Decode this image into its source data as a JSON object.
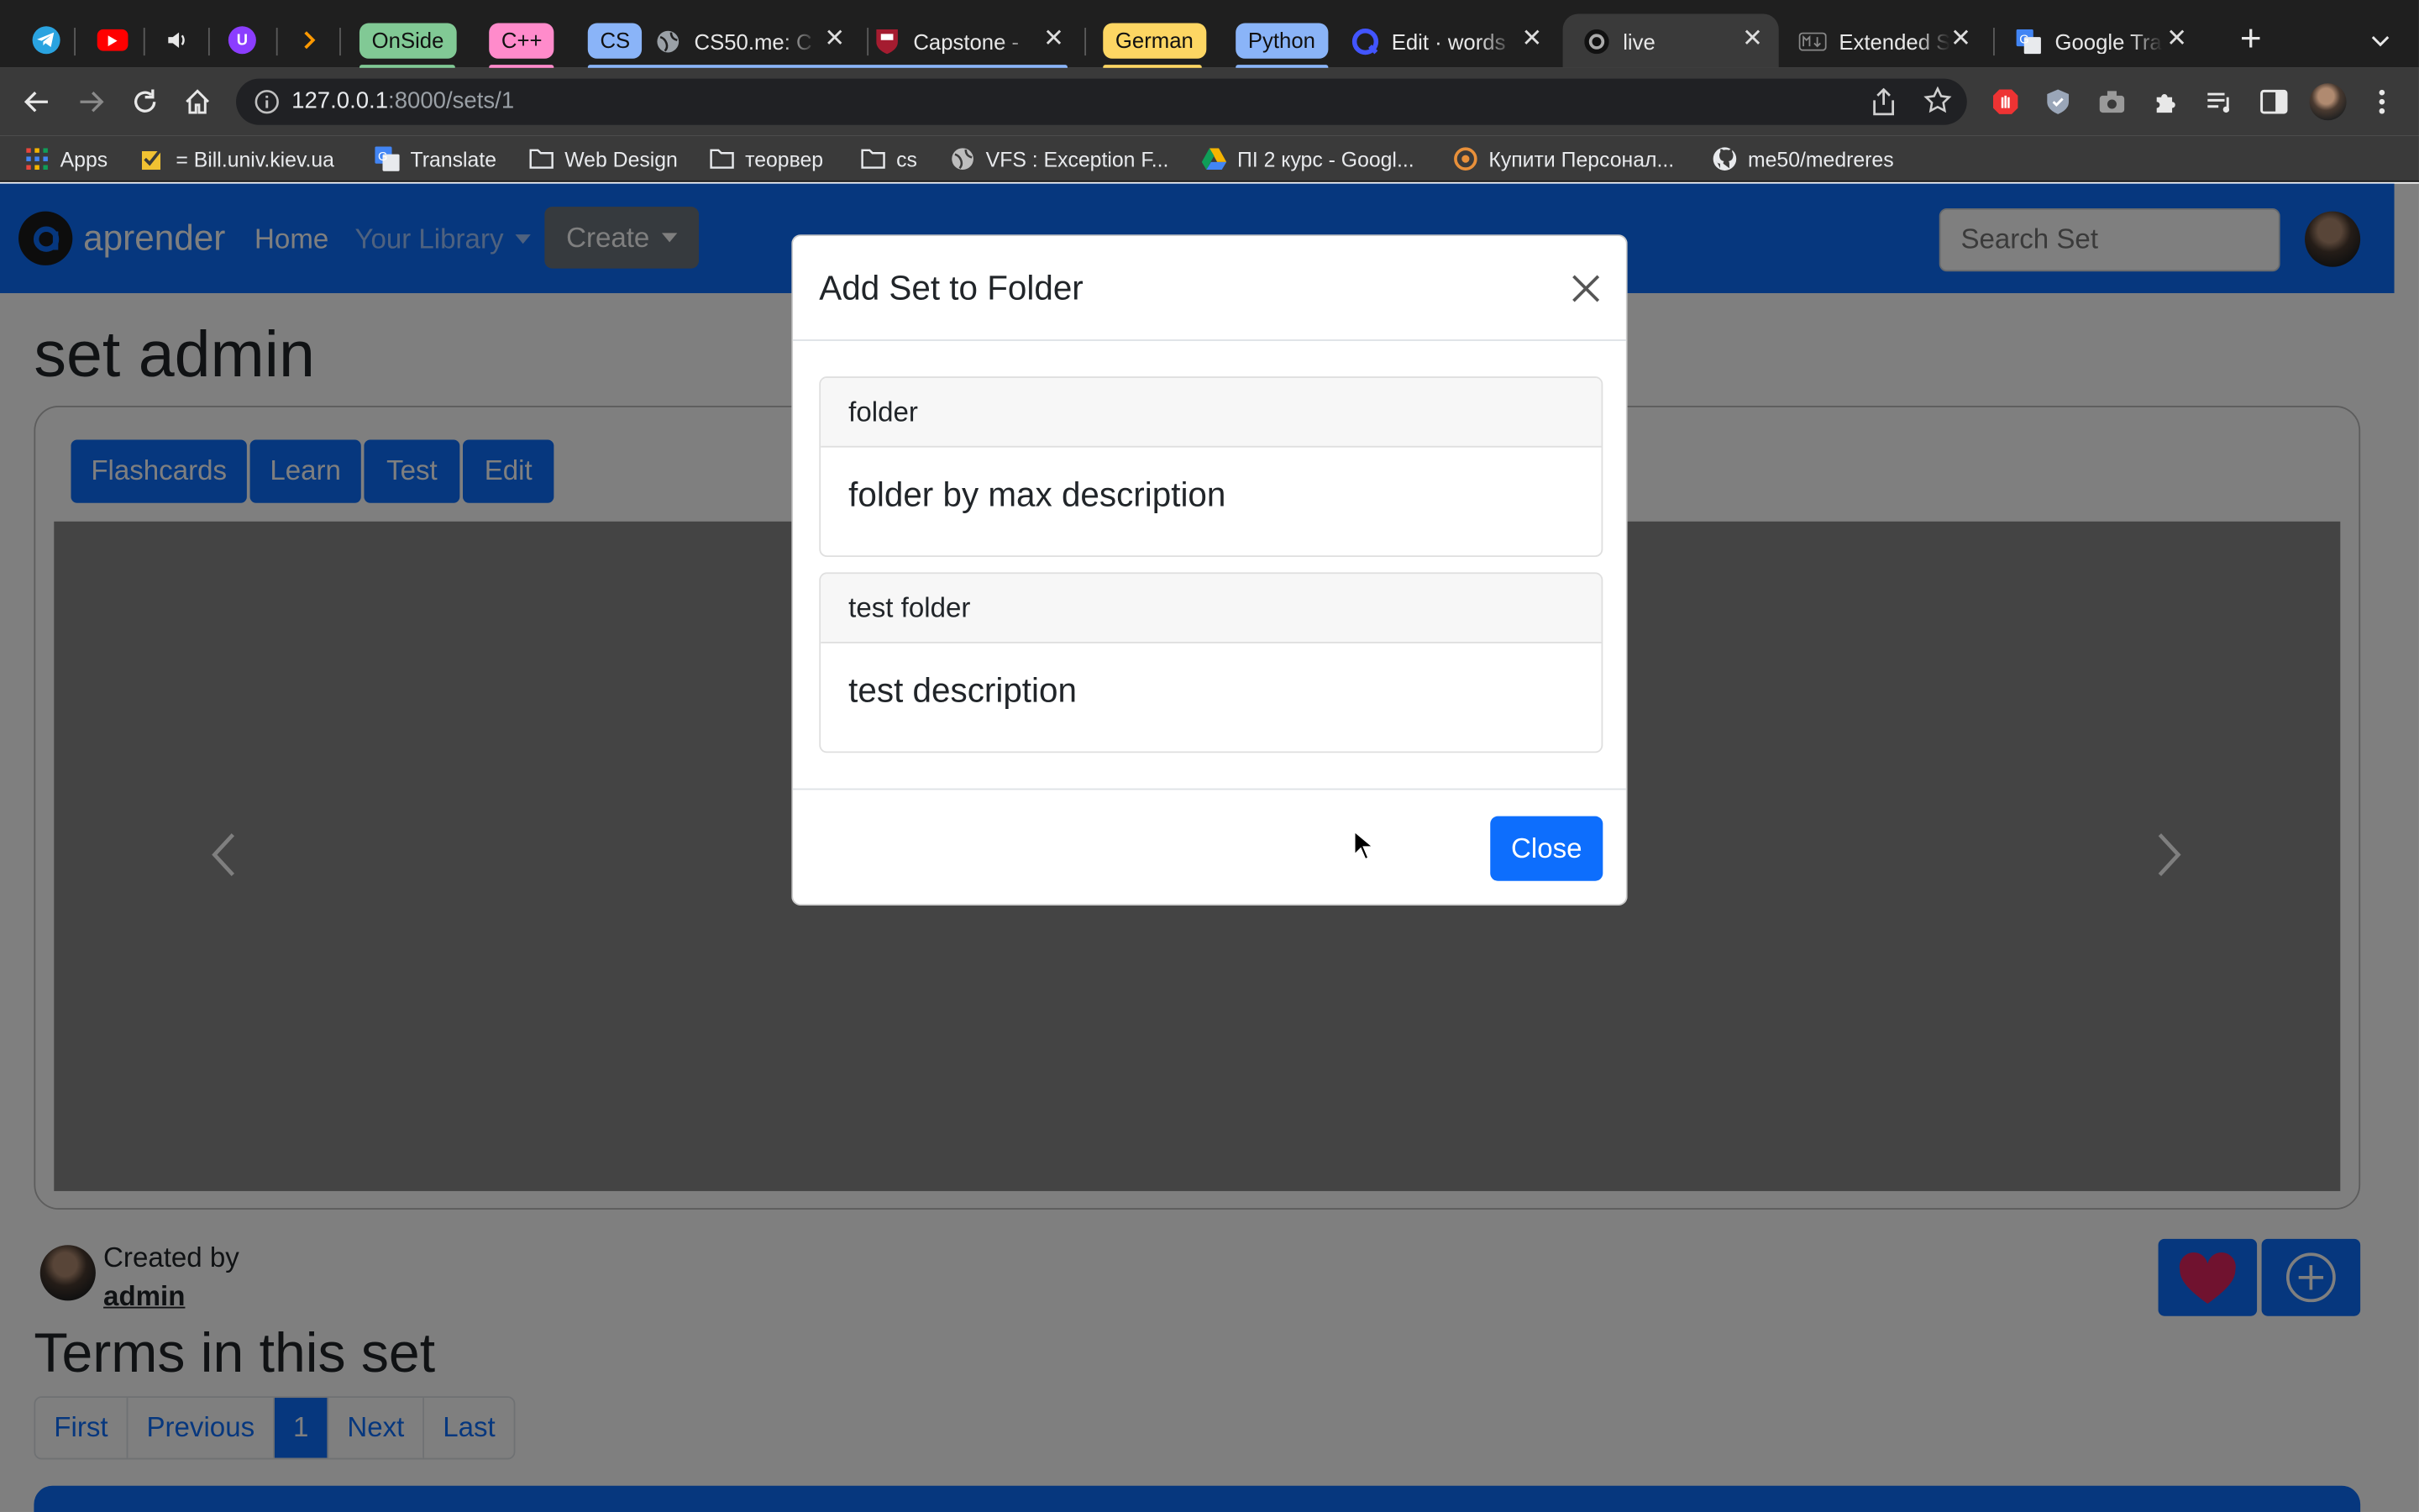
{
  "browser": {
    "pinned_tabs": [
      {
        "icon": "telegram-icon"
      },
      {
        "icon": "youtube-icon"
      },
      {
        "icon": "speaker-icon"
      },
      {
        "icon": "u-extension-icon"
      },
      {
        "icon": "amazon-icon"
      }
    ],
    "tab_groups": [
      {
        "label": "OnSide",
        "color": "#81c995"
      },
      {
        "label": "C++",
        "color": "#ff8bcb"
      },
      {
        "label": "CS",
        "color": "#8ab4f8"
      },
      {
        "label": "German",
        "color": "#fdd663"
      },
      {
        "label": "Python",
        "color": "#8ab4f8"
      }
    ],
    "tabs": [
      {
        "title": "CS50.me: C",
        "icon": "globe-icon"
      },
      {
        "title": "Capstone -",
        "icon": "harvard-shield-icon"
      },
      {
        "title": "Edit · words",
        "icon": "quizlet-icon"
      },
      {
        "title": "live",
        "icon": "aprender-icon",
        "active": true
      },
      {
        "title": "Extended S",
        "icon": "markdown-icon"
      },
      {
        "title": "Google Tran",
        "icon": "google-translate-icon"
      }
    ],
    "url_host": "127.0.0.1",
    "url_rest": ":8000/sets/1",
    "bookmarks": [
      {
        "label": "Apps",
        "icon": "apps-grid-icon"
      },
      {
        "label": "= Bill.univ.kiev.ua",
        "icon": "checkbox-icon"
      },
      {
        "label": "Translate",
        "icon": "google-translate-icon"
      },
      {
        "label": "Web Design",
        "icon": "folder-icon"
      },
      {
        "label": "теорвер",
        "icon": "folder-icon"
      },
      {
        "label": "cs",
        "icon": "folder-icon"
      },
      {
        "label": "VFS : Exception F...",
        "icon": "globe-icon"
      },
      {
        "label": "ПІ 2 курс - Googl...",
        "icon": "google-drive-icon"
      },
      {
        "label": "Купити Персонал...",
        "icon": "shop-icon"
      },
      {
        "label": "me50/medreres",
        "icon": "github-icon"
      }
    ]
  },
  "navbar": {
    "brand": "aprender",
    "home": "Home",
    "library": "Your Library",
    "create": "Create",
    "search_placeholder": "Search Set"
  },
  "set": {
    "title": "set admin",
    "modes": [
      "Flashcards",
      "Learn",
      "Test",
      "Edit"
    ],
    "created_by_label": "Created by",
    "author": "admin",
    "terms_heading": "Terms in this set"
  },
  "pagination": {
    "first": "First",
    "previous": "Previous",
    "current": "1",
    "next": "Next",
    "last": "Last"
  },
  "modal": {
    "title": "Add Set to Folder",
    "folders": [
      {
        "name": "folder",
        "description": "folder by max description"
      },
      {
        "name": "test folder",
        "description": "test description"
      }
    ],
    "close_label": "Close"
  },
  "colors": {
    "primary": "#0d6efd",
    "like_heart": "#e0245e",
    "browser_frame": "#1f1f1f"
  }
}
